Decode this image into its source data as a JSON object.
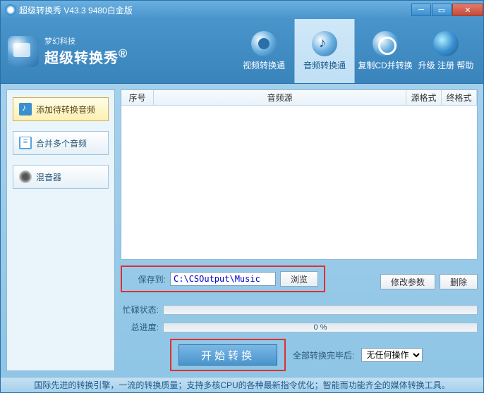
{
  "titlebar": {
    "title": "超级转换秀 V43.3 9480白金版"
  },
  "logo": {
    "small": "梦幻科技",
    "big": "超级转换秀",
    "reg": "®"
  },
  "tabs": {
    "video": "视频转换通",
    "audio": "音频转换通",
    "cd": "复制CD并转换",
    "upgrade": "升级 注册 帮助"
  },
  "sidebar": {
    "add": "添加待转换音频",
    "merge": "合并多个音频",
    "mixer": "混音器"
  },
  "table": {
    "col_index": "序号",
    "col_source": "音频源",
    "col_srcfmt": "源格式",
    "col_dstfmt": "终格式"
  },
  "saveto": {
    "label": "保存到:",
    "path": "C:\\CSOutput\\Music",
    "browse": "浏览",
    "modify": "修改参数",
    "delete": "删除"
  },
  "progress": {
    "busy_lbl": "忙碌状态:",
    "total_lbl": "总进度:",
    "total_text": "0 %"
  },
  "start": {
    "button": "开始转换",
    "after_lbl": "全部转换完毕后:",
    "after_opt": "无任何操作"
  },
  "status": "国际先进的转换引擎，一流的转换质量；支持多核CPU的各种最新指令优化；智能而功能齐全的媒体转换工具。"
}
